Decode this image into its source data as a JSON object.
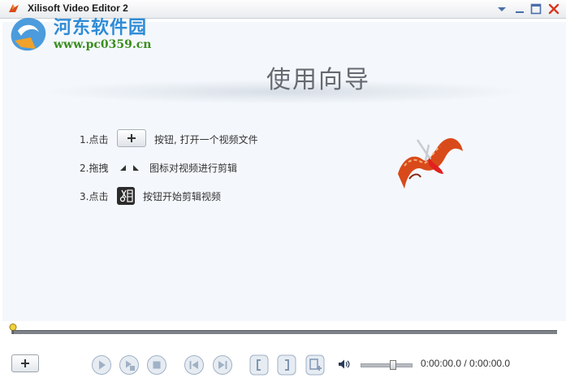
{
  "window": {
    "title": "Xilisoft Video Editor 2"
  },
  "watermark": {
    "site_name": "河东软件园",
    "url": "www.pc0359.cn"
  },
  "wizard": {
    "heading": "使用向导",
    "steps": [
      {
        "number": "1.点击",
        "text": "按钮, 打开一个视频文件"
      },
      {
        "number": "2.拖拽",
        "text": "图标对视频进行剪辑"
      },
      {
        "number": "3.点击",
        "text": "按钮开始剪辑视频"
      }
    ]
  },
  "playback": {
    "time_display": "0:00:00.0 / 0:00:00.0",
    "volume_level": 0.65,
    "position": 0.0
  },
  "colors": {
    "accent_blue": "#2e8bd6",
    "url_green": "#3a8d1e",
    "ribbon_orange": "#d94a1a",
    "close_red": "#d9361f"
  }
}
